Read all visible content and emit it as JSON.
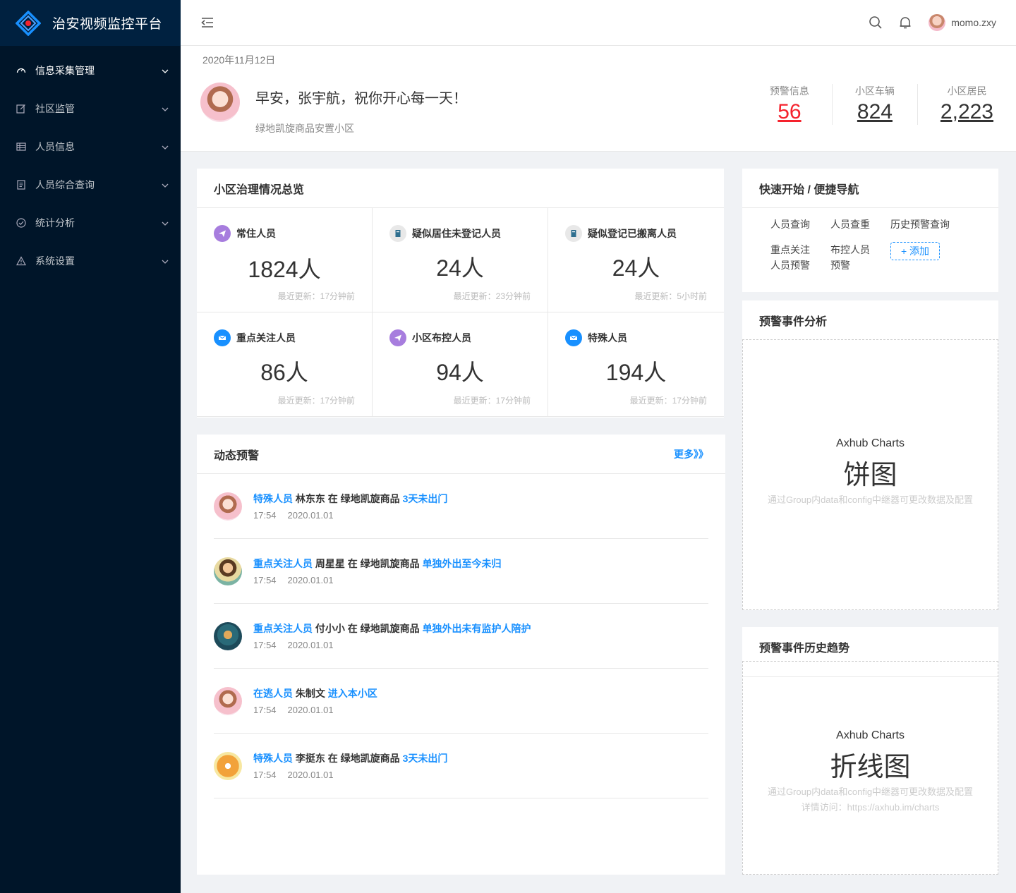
{
  "app": {
    "title": "治安视频监控平台"
  },
  "sidebar": {
    "items": [
      {
        "label": "信息采集管理",
        "icon": "dashboard-icon"
      },
      {
        "label": "社区监管",
        "icon": "edit-icon"
      },
      {
        "label": "人员信息",
        "icon": "table-icon"
      },
      {
        "label": "人员综合查询",
        "icon": "file-icon"
      },
      {
        "label": "统计分析",
        "icon": "check-circle-icon"
      },
      {
        "label": "系统设置",
        "icon": "warning-icon"
      }
    ]
  },
  "header": {
    "user_name": "momo.zxy"
  },
  "welcome": {
    "date": "2020年11月12日",
    "greeting": "早安，张宇航，祝你开心每一天！",
    "community": "绿地凯旋商品安置小区",
    "stats": [
      {
        "label": "预警信息",
        "value": "56"
      },
      {
        "label": "小区车辆",
        "value": "824"
      },
      {
        "label": "小区居民",
        "value": "2,223"
      }
    ]
  },
  "overview": {
    "title": "小区治理情况总览",
    "cells": [
      {
        "label": "常住人员",
        "value": "1824人",
        "updated": "最近更新：17分钟前"
      },
      {
        "label": "疑似居住未登记人员",
        "value": "24人",
        "updated": "最近更新：23分钟前"
      },
      {
        "label": "疑似登记已搬离人员",
        "value": "24人",
        "updated": "最近更新：5小时前"
      },
      {
        "label": "重点关注人员",
        "value": "86人",
        "updated": "最近更新：17分钟前"
      },
      {
        "label": "小区布控人员",
        "value": "94人",
        "updated": "最近更新：17分钟前"
      },
      {
        "label": "特殊人员",
        "value": "194人",
        "updated": "最近更新：17分钟前"
      }
    ]
  },
  "alerts": {
    "title": "动态预警",
    "more": "更多》》",
    "items": [
      {
        "tag": "特殊人员",
        "name": "林东东",
        "mid": "在 绿地凯旋商品",
        "event": "3天未出门",
        "time": "17:54",
        "date": "2020.01.01"
      },
      {
        "tag": "重点关注人员",
        "name": "周星星",
        "mid": "在 绿地凯旋商品",
        "event": "单独外出至今未归",
        "time": "17:54",
        "date": "2020.01.01"
      },
      {
        "tag": "重点关注人员",
        "name": "付小小",
        "mid": "在 绿地凯旋商品",
        "event": "单独外出未有监护人陪护",
        "time": "17:54",
        "date": "2020.01.01"
      },
      {
        "tag": "在逃人员",
        "name": "朱制文",
        "mid": "",
        "event": "进入本小区",
        "time": "17:54",
        "date": "2020.01.01"
      },
      {
        "tag": "特殊人员",
        "name": "李挺东",
        "mid": "在 绿地凯旋商品",
        "event": "3天未出门",
        "time": "17:54",
        "date": "2020.01.01"
      }
    ]
  },
  "quicknav": {
    "title": "快速开始 / 便捷导航",
    "items": [
      "人员查询",
      "人员查重",
      "历史预警查询",
      "重点关注人员预警",
      "布控人员预警"
    ],
    "add_label": "+ 添加"
  },
  "pie": {
    "title": "预警事件分析",
    "brand": "Axhub Charts",
    "big": "饼图",
    "note": "通过Group内data和config中继器可更改数据及配置"
  },
  "trend": {
    "title": "预警事件历史趋势",
    "brand": "Axhub Charts",
    "big": "折线图",
    "note": "通过Group内data和config中继器可更改数据及配置",
    "note2": "详情访问：https://axhub.im/charts"
  },
  "colors": {
    "sidebar_bg": "#001529",
    "logo_bg": "#002140",
    "accent": "#1890ff",
    "alert_red": "#f5222d"
  }
}
